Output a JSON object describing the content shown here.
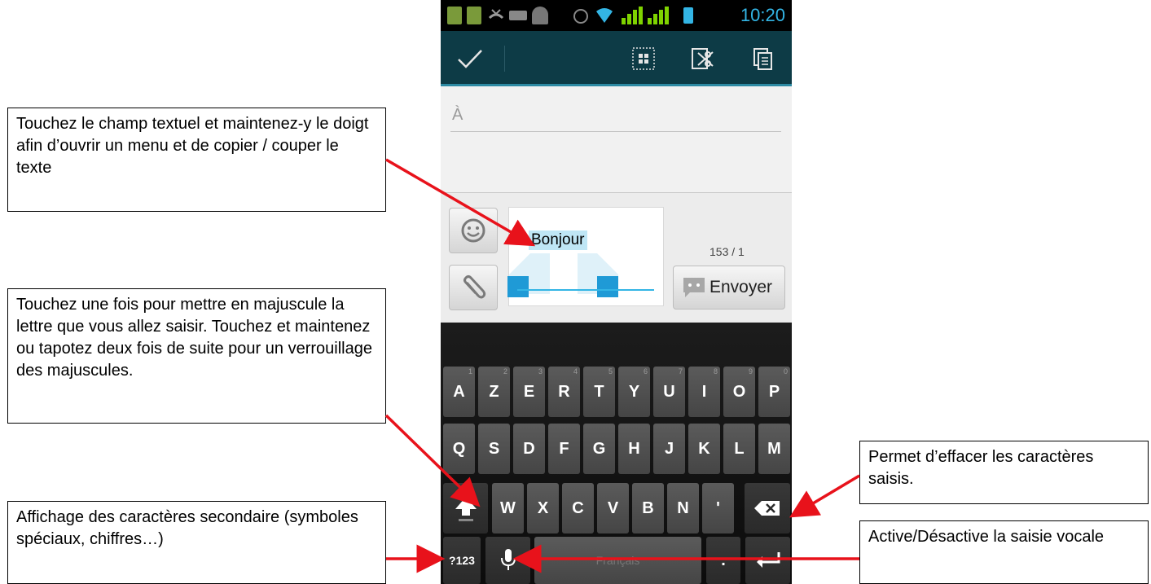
{
  "callouts": {
    "copy_cut": "Touchez le champ textuel et maintenez-y le doigt afin d’ouvrir un menu et de copier / couper le texte",
    "shift": "Touchez une fois pour mettre en majuscule la lettre que vous allez saisir. Touchez et maintenez ou tapotez deux fois de suite pour un verrouillage des majuscules.",
    "symbols": "Affichage des caractères secondaire (symboles spéciaux, chiffres…)",
    "delete": "Permet d’effacer les caractères saisis.",
    "voice": "Active/Désactive la saisie vocale"
  },
  "status_bar": {
    "time": "10:20",
    "time_color": "#33b5e5"
  },
  "compose": {
    "to_label": "À",
    "message_text": "Bonjour",
    "char_counter": "153 / 1",
    "send_label": "Envoyer"
  },
  "keyboard": {
    "row1": [
      {
        "label": "A",
        "sub": "1"
      },
      {
        "label": "Z",
        "sub": "2"
      },
      {
        "label": "E",
        "sub": "3"
      },
      {
        "label": "R",
        "sub": "4"
      },
      {
        "label": "T",
        "sub": "5"
      },
      {
        "label": "Y",
        "sub": "6"
      },
      {
        "label": "U",
        "sub": "7"
      },
      {
        "label": "I",
        "sub": "8"
      },
      {
        "label": "O",
        "sub": "9"
      },
      {
        "label": "P",
        "sub": "0"
      }
    ],
    "row2": [
      "Q",
      "S",
      "D",
      "F",
      "G",
      "H",
      "J",
      "K",
      "L",
      "M"
    ],
    "row3": [
      "W",
      "X",
      "C",
      "V",
      "B",
      "N",
      "'"
    ],
    "symbols_label": "?123",
    "space_label": "Français",
    "period_label": "."
  },
  "colors": {
    "action_bar": "#0d3b46",
    "accent": "#33b5e5",
    "arrow": "#e8121b"
  }
}
